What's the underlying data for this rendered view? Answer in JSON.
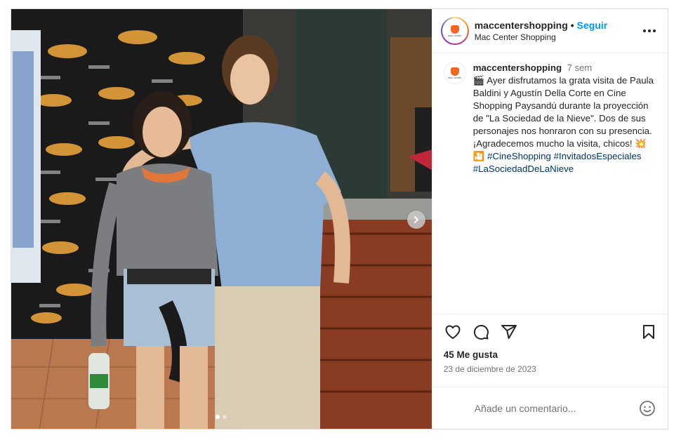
{
  "post": {
    "username": "maccentershopping",
    "separator": "•",
    "follow_label": "Seguir",
    "subtitle": "Mac Center Shopping",
    "avatar_text": "mac center"
  },
  "media": {
    "image_description_icon": "photo",
    "slide_count": 2,
    "active_slide": 1
  },
  "caption": {
    "username": "maccentershopping",
    "time": "7 sem",
    "emoji_start": "🎬",
    "text": "Ayer disfrutamos la grata visita de Paula Baldini y Agustín Della Corte en Cine Shopping Paysandú durante la proyección de \"La Sociedad de la Nieve\". Dos de sus personajes nos honraron con su presencia. ¡Agradecemos mucho la visita, chicos!",
    "emoji_mid": "💥",
    "emoji_end": "🎦",
    "hashtags": [
      "#CineShopping",
      "#InvitadosEspeciales",
      "#LaSociedadDeLaNieve"
    ]
  },
  "stats": {
    "likes": "45 Me gusta",
    "date": "23 de diciembre de 2023"
  },
  "comment": {
    "placeholder": "Añade un comentario..."
  },
  "icons": {
    "like": "heart-icon",
    "comment": "comment-icon",
    "share": "share-icon",
    "save": "bookmark-icon",
    "more": "more-icon",
    "emoji": "emoji-icon",
    "next": "chevron-right-icon"
  },
  "colors": {
    "accent": "#0095f6",
    "hashtag": "#00376b",
    "muted": "#737373",
    "border": "#dbdbdb"
  }
}
